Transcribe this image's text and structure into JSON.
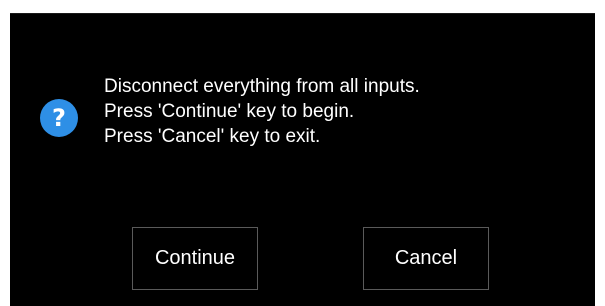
{
  "dialog": {
    "icon": "question-icon",
    "icon_glyph": "?",
    "icon_color": "#2e8fe6",
    "message_lines": [
      "Disconnect everything from all inputs.",
      "Press 'Continue' key to begin.",
      "Press 'Cancel' key to exit."
    ],
    "buttons": {
      "continue_label": "Continue",
      "cancel_label": "Cancel"
    }
  }
}
